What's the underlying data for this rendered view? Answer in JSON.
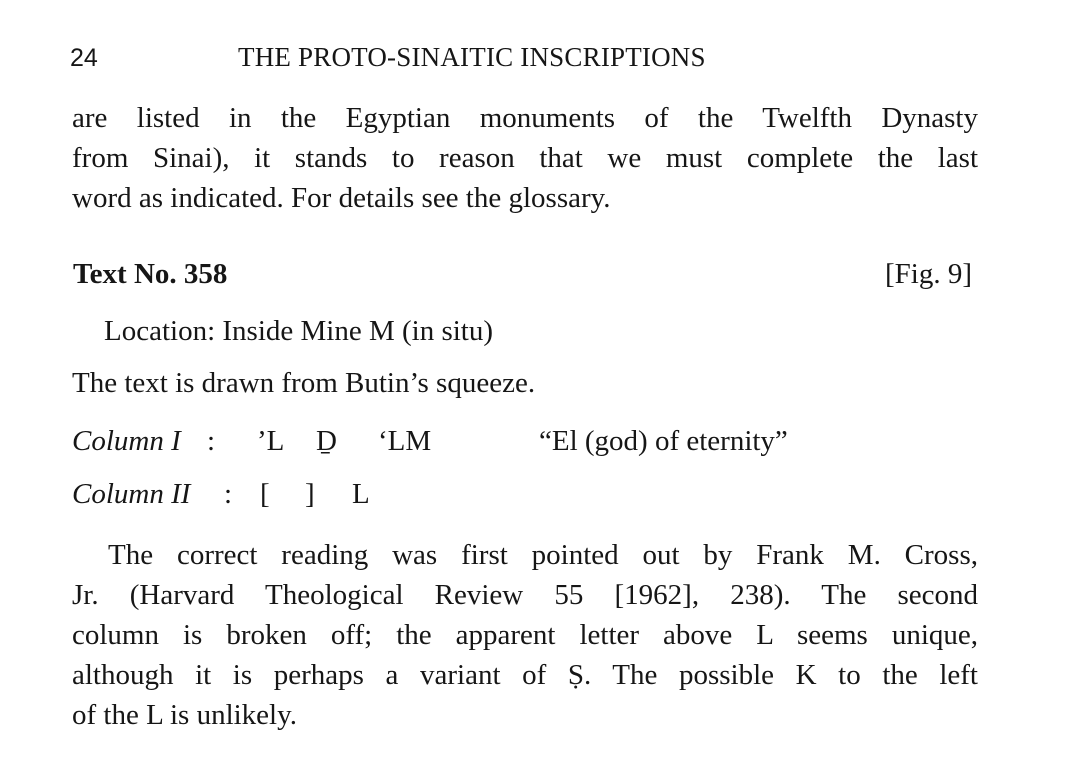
{
  "header": {
    "page_number": "24",
    "running_title": "THE PROTO-SINAITIC INSCRIPTIONS"
  },
  "intro_paragraph": {
    "lines": [
      "are listed in the Egyptian monuments of the Twelfth Dynasty",
      "from Sinai), it stands to reason that we must complete the last",
      "word as indicated. For details see the glossary."
    ]
  },
  "section": {
    "title": "Text No. 358",
    "figure_ref": "[Fig. 9]",
    "location": "Location: Inside Mine M (in situ)",
    "source_note": "The text is drawn from Butin’s squeeze."
  },
  "columns": [
    {
      "label": "Column I",
      "colon": ":",
      "letters": [
        "’L",
        "Ḏ",
        "‘LM"
      ],
      "translation": "“El (god) of eternity”"
    },
    {
      "label": "Column II",
      "colon": ":",
      "letters": [
        "[",
        "]",
        "L"
      ]
    }
  ],
  "commentary_paragraph": {
    "lines": [
      "The correct reading was first pointed out by Frank M. Cross,",
      "Jr. (Harvard Theological Review 55 [1962], 238). The second",
      "column is broken off; the apparent letter above L seems unique,",
      "although it is perhaps a variant of Ṣ. The possible K to the left",
      "of the L is unlikely."
    ]
  }
}
